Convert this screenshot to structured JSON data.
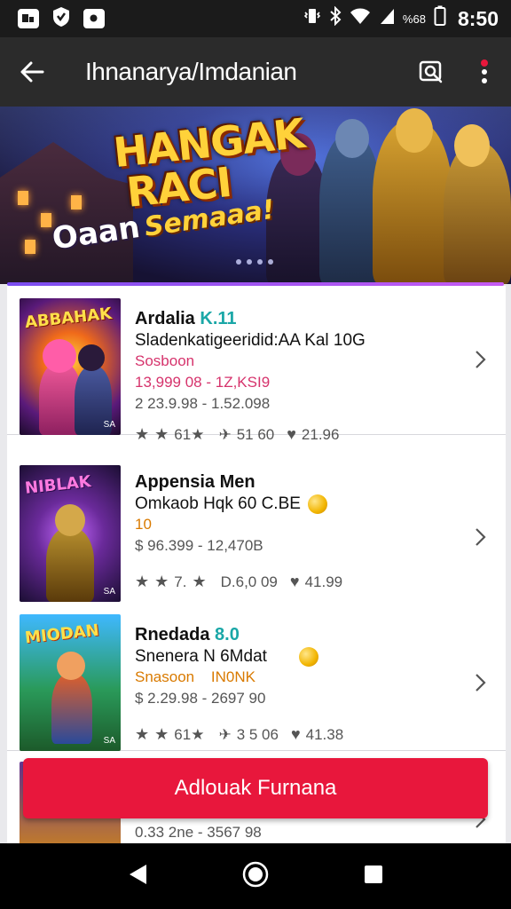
{
  "status_bar": {
    "time": "8:50",
    "battery_label": "%68"
  },
  "app_bar": {
    "title": "Ihnanarya/Imdanian"
  },
  "banner": {
    "title_line1": "HANGAK",
    "title_line2": "RACI",
    "subtitle_a": "Oaan",
    "subtitle_b": "Semaaa!",
    "page_count": 4,
    "active_page": 1
  },
  "items": [
    {
      "name": "Ardalia",
      "name_suffix": "K.11",
      "subtitle": "Sladenkatigeeridid:AA Kal 10G",
      "tag": "Sosboon",
      "price": "13,999 08 - 1Z,KSI9",
      "meta": "2 23.9.98 - 1.52.098",
      "rating_a": "61★",
      "rating_b": "51 60",
      "rating_c": "21.96",
      "cover_title": "ABBAHAK",
      "cover_tag": "SA"
    },
    {
      "name": "Appensia Men",
      "name_suffix": "",
      "subtitle": "Omkaob Hqk 60 C.BE",
      "tag": "10",
      "price": "$ 96.399 - 12,470B",
      "meta": "",
      "rating_a": "7.",
      "rating_b": "D.6,0 09",
      "rating_c": "41.99",
      "cover_title": "NIBLAK",
      "cover_tag": "SA"
    },
    {
      "name": "Rnedada",
      "name_suffix": "8.0",
      "subtitle": "Snenera N 6Mdat",
      "tag": "Snasoon",
      "tag_b": "IN0NK",
      "price": "$ 2.29.98 - 2697 90",
      "meta": "",
      "rating_a": "61★",
      "rating_b": "3 5 06",
      "rating_c": "41.38",
      "cover_title": "MIODAN",
      "cover_tag": "SA"
    },
    {
      "name": "",
      "name_suffix": "",
      "subtitle": "",
      "tag": "",
      "price": "0.33 2ne - 3567 98",
      "meta": "",
      "rating_a": "",
      "rating_b": "",
      "rating_c": "",
      "cover_title": "",
      "cover_tag": ""
    }
  ],
  "cta": {
    "label": "Adlouak Furnana"
  },
  "colors": {
    "accent": "#e8173c",
    "app_bar": "#2b2b2b",
    "highlight": "#1aa7a7",
    "tag_pink": "#d6336c"
  }
}
